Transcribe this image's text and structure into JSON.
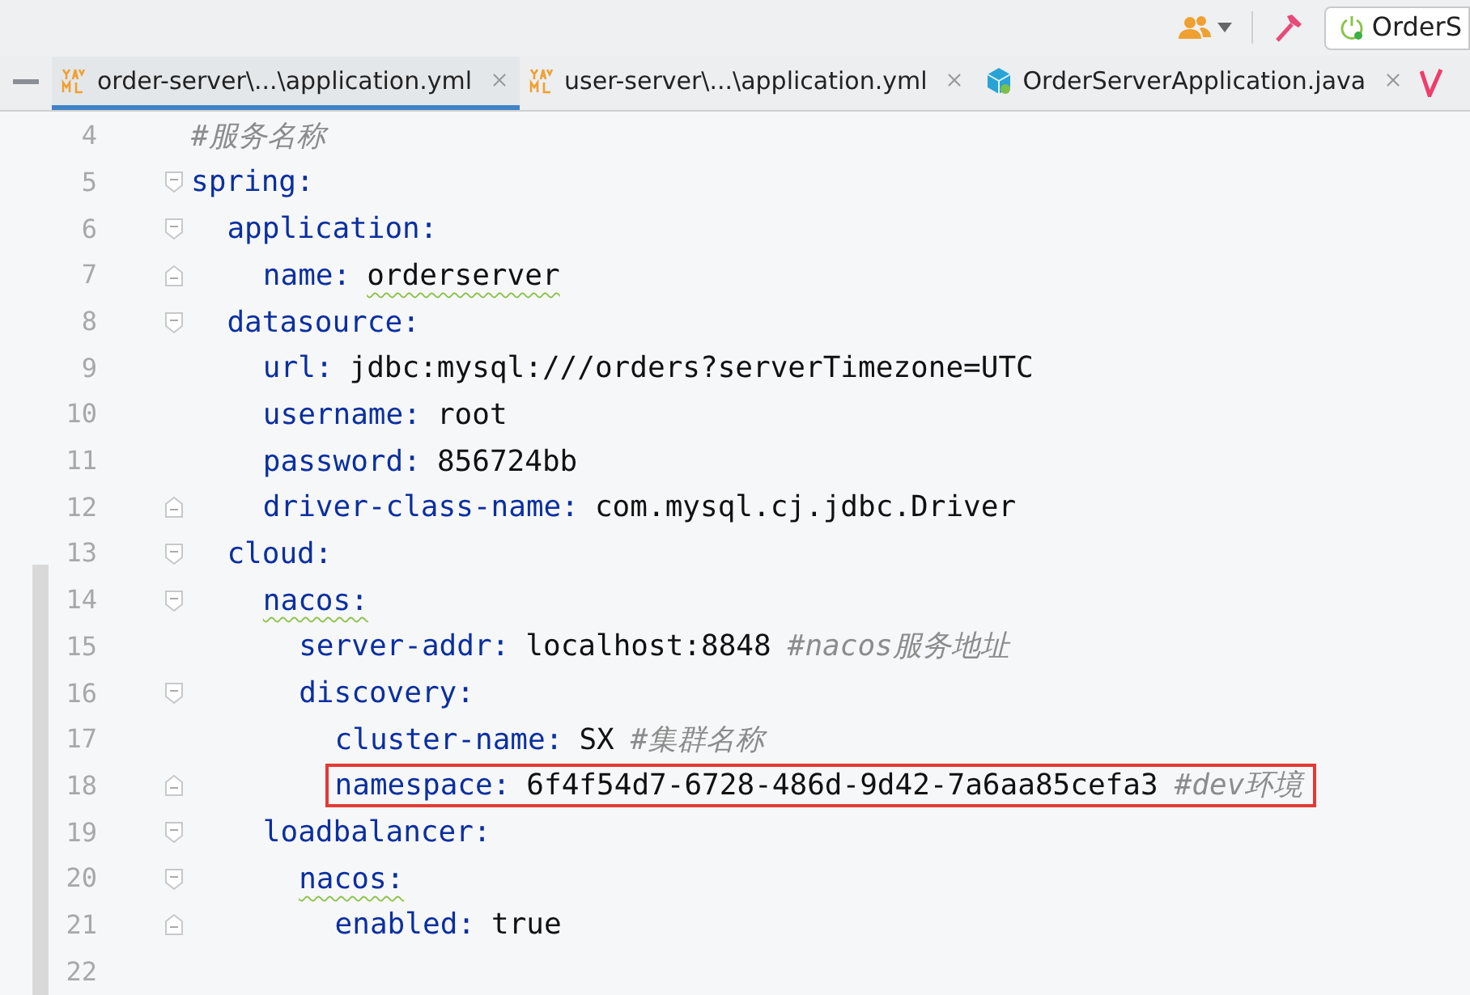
{
  "toolbar": {
    "run_config": {
      "label": "OrderS"
    }
  },
  "tabs": [
    {
      "label": "order-server\\...\\application.yml",
      "kind": "yaml",
      "selected": true
    },
    {
      "label": "user-server\\...\\application.yml",
      "kind": "yaml",
      "selected": false
    },
    {
      "label": "OrderServerApplication.java",
      "kind": "java",
      "selected": false
    }
  ],
  "lines": [
    {
      "number": "4",
      "comment": "#服务名称"
    },
    {
      "number": "5",
      "key": "spring:",
      "fold_start": true,
      "children": [
        {
          "number": "6",
          "key": "application:",
          "fold_start": true,
          "children": [
            {
              "number": "7",
              "key": "name:",
              "value": "orderserver",
              "value_warning": true,
              "fold_end": true
            }
          ]
        },
        {
          "number": "8",
          "key": "datasource:",
          "fold_start": true,
          "children": [
            {
              "number": "9",
              "key": "url:",
              "value": "jdbc:mysql:///orders?serverTimezone=UTC"
            },
            {
              "number": "10",
              "key": "username:",
              "value": "root"
            },
            {
              "number": "11",
              "key": "password:",
              "value": "856724bb"
            },
            {
              "number": "12",
              "key": "driver-class-name:",
              "value": "com.mysql.cj.jdbc.Driver",
              "fold_end": true
            }
          ]
        },
        {
          "number": "13",
          "key": "cloud:",
          "fold_start": true,
          "children": [
            {
              "number": "14",
              "key": "nacos:",
              "key_warning": true,
              "fold_start": true,
              "children": [
                {
                  "number": "15",
                  "key": "server-addr:",
                  "value": "localhost:8848",
                  "comment": "#nacos服务地址"
                },
                {
                  "number": "16",
                  "key": "discovery:",
                  "fold_start": true,
                  "children": [
                    {
                      "number": "17",
                      "key": "cluster-name:",
                      "value": "SX",
                      "comment": "#集群名称"
                    },
                    {
                      "number": "18",
                      "key": "namespace:",
                      "value": "6f4f54d7-6728-486d-9d42-7a6aa85cefa3",
                      "comment": "#dev环境",
                      "boxed": true,
                      "fold_end": true
                    }
                  ]
                }
              ]
            },
            {
              "number": "19",
              "key": "loadbalancer:",
              "fold_start": true,
              "children": [
                {
                  "number": "20",
                  "key": "nacos:",
                  "key_warning": true,
                  "fold_start": true,
                  "children": [
                    {
                      "number": "21",
                      "key": "enabled:",
                      "value": "true",
                      "fold_end": true
                    }
                  ]
                }
              ]
            }
          ]
        }
      ]
    },
    {
      "number": "22"
    }
  ]
}
